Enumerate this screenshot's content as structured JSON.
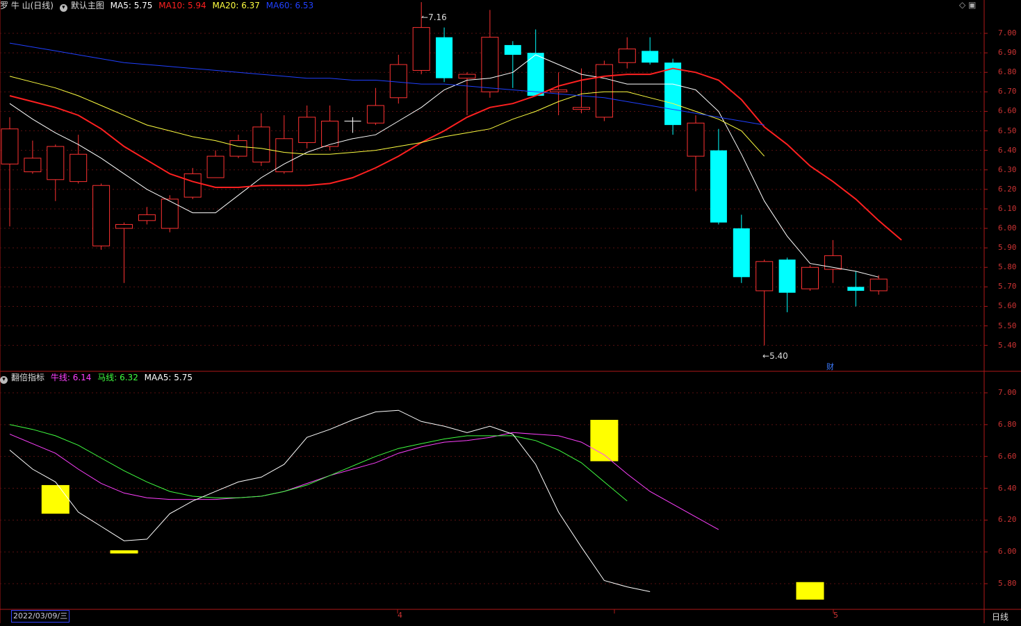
{
  "main_chart": {
    "title": "罗 牛 山(日线)",
    "template": "默认主图",
    "ma_labels": [
      {
        "text": "MA5: 5.75",
        "color": "#ffffff"
      },
      {
        "text": "MA10: 5.94",
        "color": "#ff2020"
      },
      {
        "text": "MA20: 6.37",
        "color": "#ffff40"
      },
      {
        "text": "MA60: 6.53",
        "color": "#2040ff"
      }
    ],
    "high_label": "7.16",
    "low_label": "5.40",
    "finance_marker": "财"
  },
  "sub_chart": {
    "title": "翻倍指标",
    "labels": [
      {
        "text": "牛线: 6.14",
        "color": "#ff40ff"
      },
      {
        "text": "马线: 6.32",
        "color": "#40ff40"
      },
      {
        "text": "MAA5: 5.75",
        "color": "#ffffff"
      }
    ]
  },
  "axes": {
    "main_ticks": [
      "7.00",
      "6.90",
      "6.80",
      "6.70",
      "6.60",
      "6.50",
      "6.40",
      "6.30",
      "6.20",
      "6.10",
      "6.00",
      "5.90",
      "5.80",
      "5.70",
      "5.60",
      "5.50",
      "5.40"
    ],
    "sub_ticks": [
      "7.00",
      "6.80",
      "6.60",
      "6.40",
      "6.20",
      "6.00",
      "5.80"
    ],
    "date_box": "2022/03/09/三",
    "month_labels": [
      "4",
      "5"
    ],
    "period": "日线"
  },
  "chart_data": {
    "type": "candlestick",
    "main": {
      "ylim": [
        5.35,
        7.18
      ],
      "candles": [
        {
          "o": 6.33,
          "h": 6.57,
          "l": 6.01,
          "c": 6.51
        },
        {
          "o": 6.29,
          "h": 6.45,
          "l": 6.28,
          "c": 6.36
        },
        {
          "o": 6.25,
          "h": 6.43,
          "l": 6.14,
          "c": 6.42
        },
        {
          "o": 6.24,
          "h": 6.48,
          "l": 6.23,
          "c": 6.38
        },
        {
          "o": 5.91,
          "h": 6.23,
          "l": 5.89,
          "c": 6.22
        },
        {
          "o": 6.0,
          "h": 6.03,
          "l": 5.72,
          "c": 6.02
        },
        {
          "o": 6.04,
          "h": 6.11,
          "l": 6.02,
          "c": 6.07
        },
        {
          "o": 6.0,
          "h": 6.17,
          "l": 5.98,
          "c": 6.15
        },
        {
          "o": 6.16,
          "h": 6.31,
          "l": 6.15,
          "c": 6.28
        },
        {
          "o": 6.26,
          "h": 6.4,
          "l": 6.26,
          "c": 6.37
        },
        {
          "o": 6.37,
          "h": 6.48,
          "l": 6.36,
          "c": 6.45
        },
        {
          "o": 6.34,
          "h": 6.59,
          "l": 6.32,
          "c": 6.52
        },
        {
          "o": 6.29,
          "h": 6.58,
          "l": 6.28,
          "c": 6.46
        },
        {
          "o": 6.44,
          "h": 6.63,
          "l": 6.41,
          "c": 6.57
        },
        {
          "o": 6.42,
          "h": 6.63,
          "l": 6.4,
          "c": 6.55
        },
        {
          "o": 6.55,
          "h": 6.57,
          "l": 6.49,
          "c": 6.55
        },
        {
          "o": 6.54,
          "h": 6.72,
          "l": 6.53,
          "c": 6.63
        },
        {
          "o": 6.67,
          "h": 6.89,
          "l": 6.64,
          "c": 6.84
        },
        {
          "o": 6.81,
          "h": 7.16,
          "l": 6.79,
          "c": 7.03
        },
        {
          "o": 6.98,
          "h": 7.03,
          "l": 6.75,
          "c": 6.77
        },
        {
          "o": 6.77,
          "h": 6.8,
          "l": 6.58,
          "c": 6.79
        },
        {
          "o": 6.7,
          "h": 7.12,
          "l": 6.67,
          "c": 6.98
        },
        {
          "o": 6.94,
          "h": 6.96,
          "l": 6.72,
          "c": 6.89
        },
        {
          "o": 6.9,
          "h": 7.02,
          "l": 6.68,
          "c": 6.68
        },
        {
          "o": 6.7,
          "h": 6.8,
          "l": 6.58,
          "c": 6.71
        },
        {
          "o": 6.61,
          "h": 6.82,
          "l": 6.59,
          "c": 6.62
        },
        {
          "o": 6.57,
          "h": 6.86,
          "l": 6.55,
          "c": 6.84
        },
        {
          "o": 6.85,
          "h": 6.98,
          "l": 6.82,
          "c": 6.92
        },
        {
          "o": 6.91,
          "h": 6.98,
          "l": 6.84,
          "c": 6.85
        },
        {
          "o": 6.85,
          "h": 6.87,
          "l": 6.48,
          "c": 6.53
        },
        {
          "o": 6.37,
          "h": 6.58,
          "l": 6.19,
          "c": 6.54
        },
        {
          "o": 6.4,
          "h": 6.51,
          "l": 6.02,
          "c": 6.03
        },
        {
          "o": 6.0,
          "h": 6.07,
          "l": 5.72,
          "c": 5.75
        },
        {
          "o": 5.68,
          "h": 5.84,
          "l": 5.4,
          "c": 5.83
        },
        {
          "o": 5.84,
          "h": 5.85,
          "l": 5.57,
          "c": 5.67
        },
        {
          "o": 5.69,
          "h": 5.81,
          "l": 5.68,
          "c": 5.8
        },
        {
          "o": 5.79,
          "h": 5.94,
          "l": 5.72,
          "c": 5.86
        },
        {
          "o": 5.7,
          "h": 5.78,
          "l": 5.6,
          "c": 5.68
        },
        {
          "o": 5.68,
          "h": 5.76,
          "l": 5.66,
          "c": 5.74
        }
      ],
      "series": [
        {
          "name": "MA5",
          "color": "#ffffff",
          "values": [
            6.64,
            6.56,
            6.49,
            6.43,
            6.36,
            6.28,
            6.2,
            6.14,
            6.08,
            6.08,
            6.17,
            6.26,
            6.33,
            6.39,
            6.43,
            6.46,
            6.48,
            6.55,
            6.62,
            6.71,
            6.76,
            6.77,
            6.8,
            6.89,
            6.84,
            6.79,
            6.77,
            6.74,
            6.74,
            6.74,
            6.71,
            6.6,
            6.38,
            6.14,
            5.96,
            5.82,
            5.8,
            5.78,
            5.75
          ]
        },
        {
          "name": "MA10",
          "color": "#ff2020",
          "values": [
            6.68,
            6.65,
            6.62,
            6.58,
            6.51,
            6.42,
            6.35,
            6.28,
            6.24,
            6.21,
            6.21,
            6.22,
            6.22,
            6.22,
            6.23,
            6.26,
            6.31,
            6.37,
            6.44,
            6.5,
            6.57,
            6.62,
            6.64,
            6.68,
            6.73,
            6.76,
            6.78,
            6.79,
            6.79,
            6.82,
            6.8,
            6.76,
            6.66,
            6.52,
            6.43,
            6.32,
            6.24,
            6.15,
            6.04,
            5.94
          ]
        },
        {
          "name": "MA20",
          "color": "#ffff40",
          "values": [
            6.78,
            6.75,
            6.72,
            6.68,
            6.63,
            6.58,
            6.53,
            6.5,
            6.47,
            6.45,
            6.42,
            6.41,
            6.39,
            6.38,
            6.38,
            6.39,
            6.4,
            6.42,
            6.44,
            6.47,
            6.49,
            6.51,
            6.56,
            6.6,
            6.65,
            6.69,
            6.7,
            6.7,
            6.67,
            6.64,
            6.6,
            6.56,
            6.5,
            6.37
          ]
        },
        {
          "name": "MA60",
          "color": "#2040ff",
          "values": [
            6.95,
            6.93,
            6.91,
            6.89,
            6.87,
            6.85,
            6.84,
            6.83,
            6.82,
            6.81,
            6.8,
            6.79,
            6.78,
            6.77,
            6.77,
            6.76,
            6.76,
            6.75,
            6.74,
            6.74,
            6.73,
            6.72,
            6.71,
            6.7,
            6.69,
            6.68,
            6.67,
            6.65,
            6.63,
            6.61,
            6.59,
            6.57,
            6.55,
            6.53
          ]
        }
      ]
    },
    "sub": {
      "ylim": [
        5.65,
        7.1
      ],
      "series": [
        {
          "name": "牛线",
          "color": "#ff40ff",
          "values": [
            6.74,
            6.68,
            6.62,
            6.52,
            6.43,
            6.37,
            6.34,
            6.33,
            6.33,
            6.33,
            6.34,
            6.35,
            6.38,
            6.43,
            6.48,
            6.52,
            6.56,
            6.62,
            6.66,
            6.69,
            6.7,
            6.72,
            6.75,
            6.74,
            6.73,
            6.69,
            6.61,
            6.49,
            6.38,
            6.3,
            6.22,
            6.14
          ]
        },
        {
          "name": "马线",
          "color": "#40ff40",
          "values": [
            6.8,
            6.77,
            6.73,
            6.67,
            6.59,
            6.51,
            6.44,
            6.38,
            6.35,
            6.34,
            6.34,
            6.35,
            6.38,
            6.42,
            6.48,
            6.54,
            6.6,
            6.65,
            6.68,
            6.71,
            6.73,
            6.73,
            6.73,
            6.7,
            6.64,
            6.56,
            6.44,
            6.32
          ]
        },
        {
          "name": "MAA5",
          "color": "#ffffff",
          "values": [
            6.64,
            6.52,
            6.44,
            6.25,
            6.16,
            6.07,
            6.08,
            6.24,
            6.32,
            6.38,
            6.44,
            6.47,
            6.55,
            6.72,
            6.77,
            6.83,
            6.88,
            6.89,
            6.82,
            6.79,
            6.75,
            6.79,
            6.74,
            6.55,
            6.25,
            6.03,
            5.82,
            5.78,
            5.75
          ]
        }
      ],
      "signals": [
        {
          "index": 2,
          "top": 6.42,
          "bottom": 6.24
        },
        {
          "index": 5,
          "top": 6.01,
          "bottom": 5.99
        },
        {
          "index": 26,
          "top": 6.83,
          "bottom": 6.57
        },
        {
          "index": 35,
          "top": 5.81,
          "bottom": 5.7
        }
      ]
    }
  }
}
